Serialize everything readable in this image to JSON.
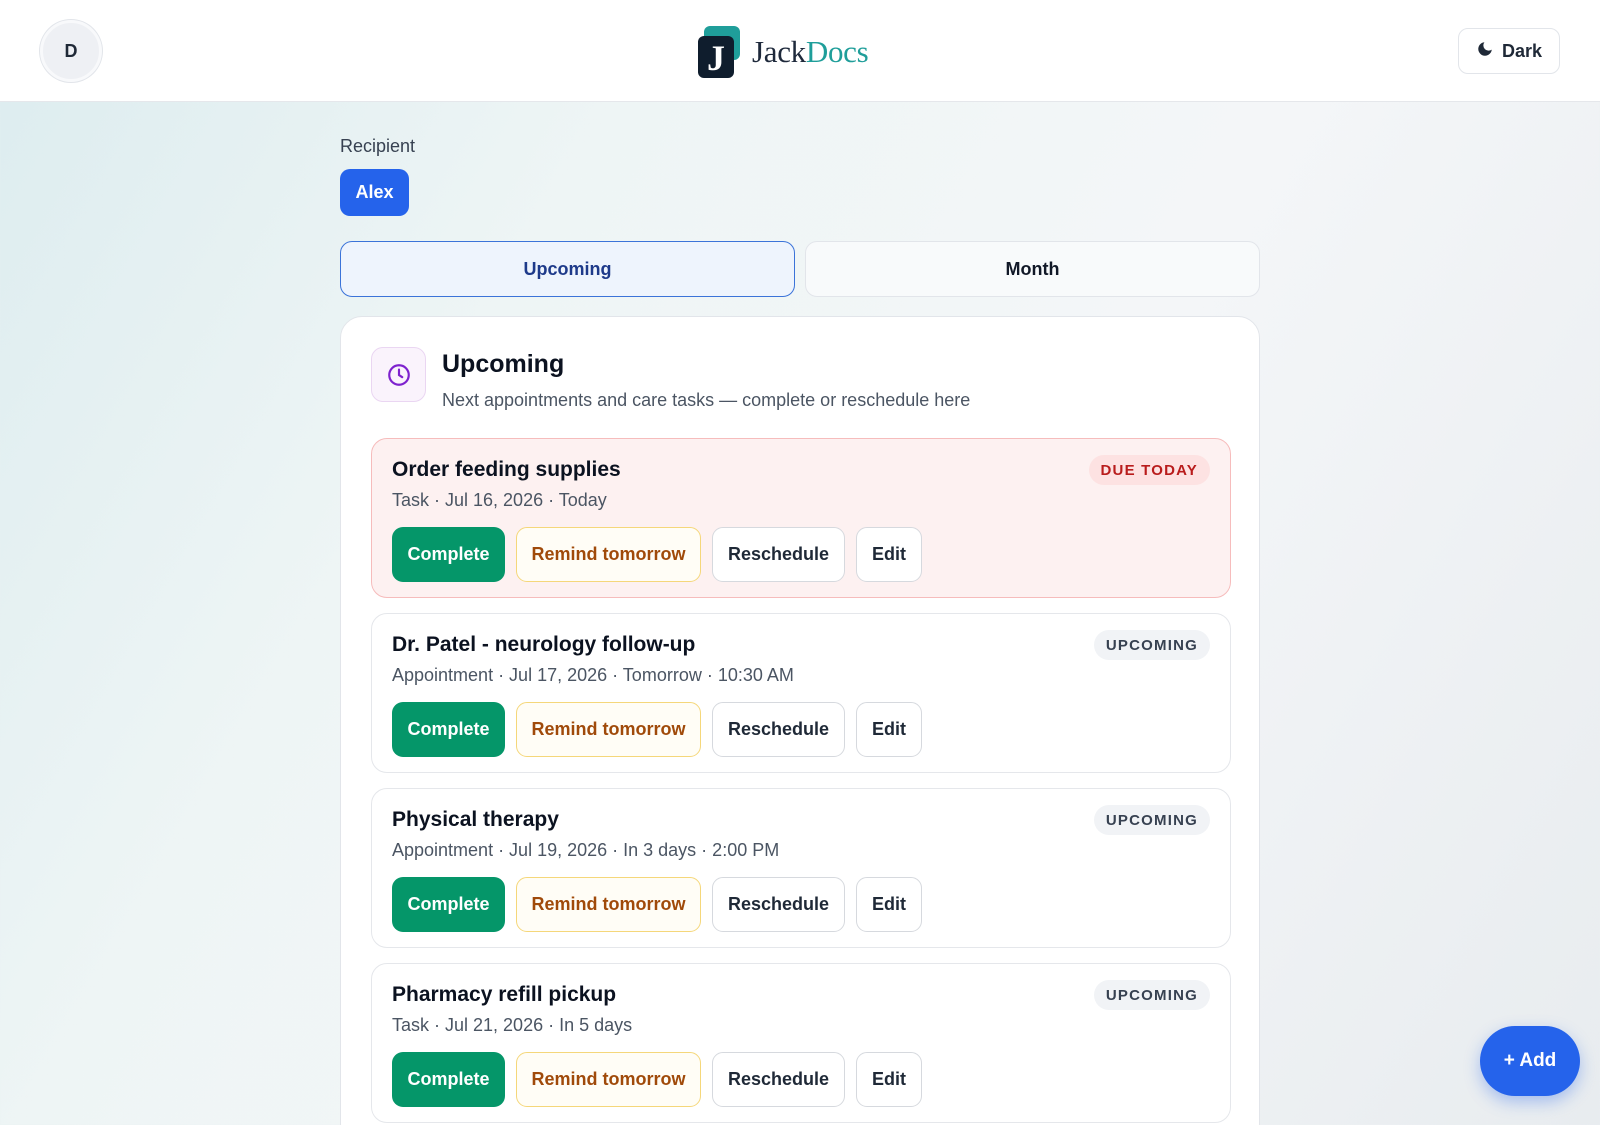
{
  "header": {
    "avatar_initial": "D",
    "logo": {
      "text_primary": "Jack",
      "text_accent": "Docs",
      "accent_color": "#1f9e9a"
    },
    "theme_toggle": {
      "label": "Dark",
      "icon": "moon-icon"
    }
  },
  "recipient": {
    "label": "Recipient",
    "selected": "Alex"
  },
  "tabs": [
    {
      "label": "Upcoming",
      "active": true
    },
    {
      "label": "Month",
      "active": false
    }
  ],
  "panel": {
    "icon": "clock-icon",
    "title": "Upcoming",
    "subtitle": "Next appointments and care tasks — complete or reschedule here",
    "items": [
      {
        "title": "Order feeding supplies",
        "meta": "Task · Jul 16, 2026 · Today",
        "badge": "DUE TODAY",
        "status": "due",
        "actions": {
          "complete": "Complete",
          "remind": "Remind tomorrow",
          "reschedule": "Reschedule",
          "edit": "Edit"
        }
      },
      {
        "title": "Dr. Patel - neurology follow-up",
        "meta": "Appointment · Jul 17, 2026 · Tomorrow · 10:30 AM",
        "badge": "UPCOMING",
        "status": "upcoming",
        "actions": {
          "complete": "Complete",
          "remind": "Remind tomorrow",
          "reschedule": "Reschedule",
          "edit": "Edit"
        }
      },
      {
        "title": "Physical therapy",
        "meta": "Appointment · Jul 19, 2026 · In 3 days · 2:00 PM",
        "badge": "UPCOMING",
        "status": "upcoming",
        "actions": {
          "complete": "Complete",
          "remind": "Remind tomorrow",
          "reschedule": "Reschedule",
          "edit": "Edit"
        }
      },
      {
        "title": "Pharmacy refill pickup",
        "meta": "Task · Jul 21, 2026 · In 5 days",
        "badge": "UPCOMING",
        "status": "upcoming",
        "actions": {
          "complete": "Complete",
          "remind": "Remind tomorrow",
          "reschedule": "Reschedule",
          "edit": "Edit"
        }
      }
    ]
  },
  "fab": {
    "label": "+ Add"
  },
  "colors": {
    "primary": "#2563eb",
    "complete": "#059669",
    "due_text": "#b91c1c",
    "remind_text": "#a04a0a"
  }
}
